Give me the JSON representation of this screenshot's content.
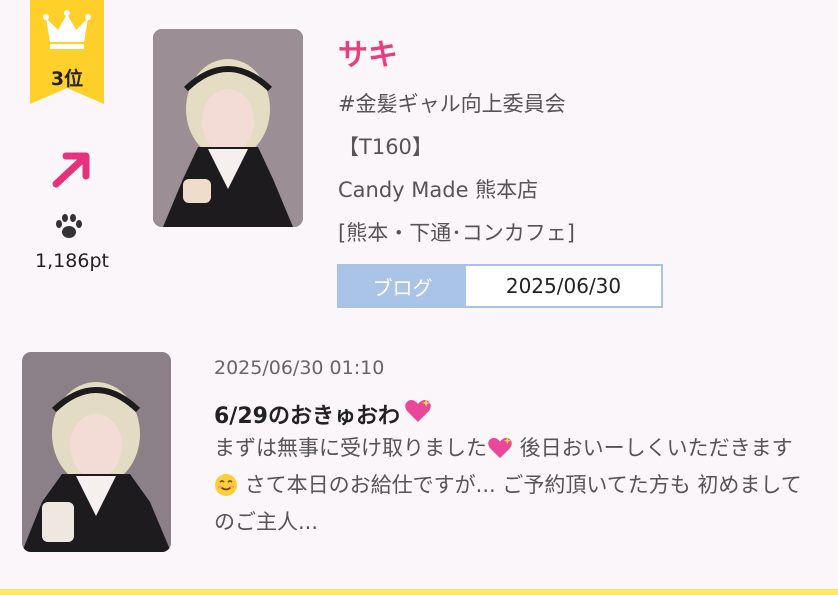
{
  "rank": {
    "label": "3位",
    "trend": "up",
    "points": "1,186pt"
  },
  "profile": {
    "name": "サキ",
    "tagline": "#金髪ギャル向上委員会",
    "height": "【T160】",
    "shop": "Candy Made 熊本店",
    "area": "[熊本・下通･コンカフェ]",
    "blog_tag": "ブログ",
    "blog_date": "2025/06/30",
    "photo": "maid-portrait"
  },
  "post": {
    "datetime": "2025/06/30 01:10",
    "title": "6/29のおきゅおわ",
    "excerpt_part1": "まずは無事に受け取りました",
    "excerpt_part2": " 後日おいーしくいただきます",
    "excerpt_part3": " さて本日のお給仕ですが... ご予約頂いてた方も 初めましてのご主人...",
    "photo": "maid-portrait"
  },
  "icons": {
    "crown": "crown-icon",
    "trend": "trend-up-arrow-icon",
    "paw": "paw-icon",
    "sparkle_heart": "sparkling-heart-icon",
    "smile": "smiling-face-icon"
  },
  "colors": {
    "ribbon": "#ffd02a",
    "name": "#e83d7e",
    "arrow": "#e5317e",
    "blog_tag": "#a9c4e7",
    "background": "#fbf6f9"
  }
}
